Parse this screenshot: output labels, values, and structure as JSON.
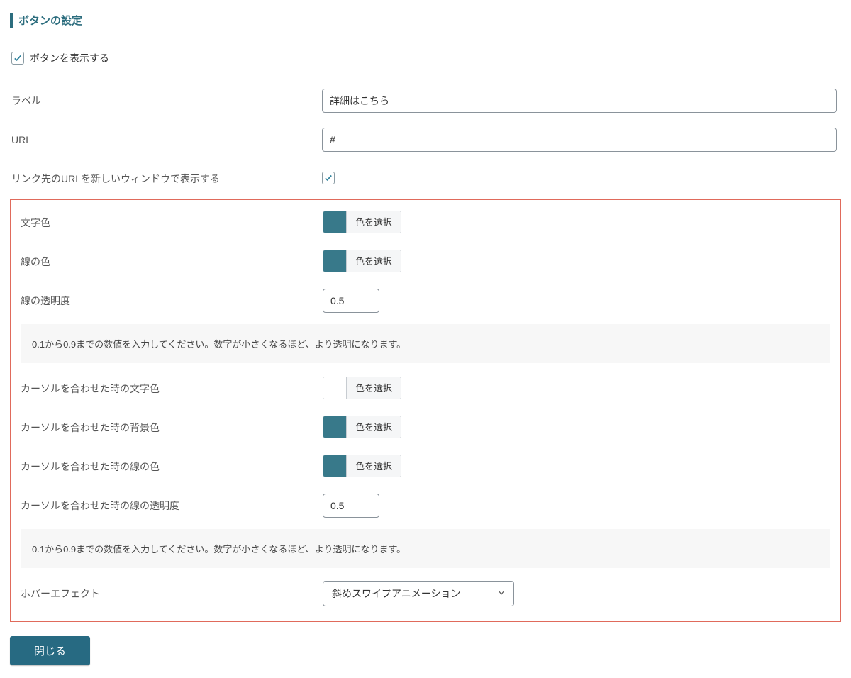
{
  "section_title": "ボタンの設定",
  "show_button": {
    "label": "ボタンを表示する",
    "checked": true
  },
  "fields": {
    "label_field": {
      "label": "ラベル",
      "value": "詳細はこちら"
    },
    "url_field": {
      "label": "URL",
      "value": "#"
    },
    "new_window": {
      "label": "リンク先のURLを新しいウィンドウで表示する",
      "checked": true
    }
  },
  "color_select_label": "色を選択",
  "boxed": {
    "text_color": {
      "label": "文字色",
      "swatch": "teal"
    },
    "line_color": {
      "label": "線の色",
      "swatch": "teal"
    },
    "line_opacity": {
      "label": "線の透明度",
      "value": "0.5"
    },
    "opacity_help": "0.1から0.9までの数値を入力してください。数字が小さくなるほど、より透明になります。",
    "hover_text_color": {
      "label": "カーソルを合わせた時の文字色",
      "swatch": "white"
    },
    "hover_bg_color": {
      "label": "カーソルを合わせた時の背景色",
      "swatch": "teal"
    },
    "hover_line_color": {
      "label": "カーソルを合わせた時の線の色",
      "swatch": "teal"
    },
    "hover_line_opacity": {
      "label": "カーソルを合わせた時の線の透明度",
      "value": "0.5"
    },
    "hover_effect": {
      "label": "ホバーエフェクト",
      "value": "斜めスワイプアニメーション"
    }
  },
  "close_label": "閉じる"
}
